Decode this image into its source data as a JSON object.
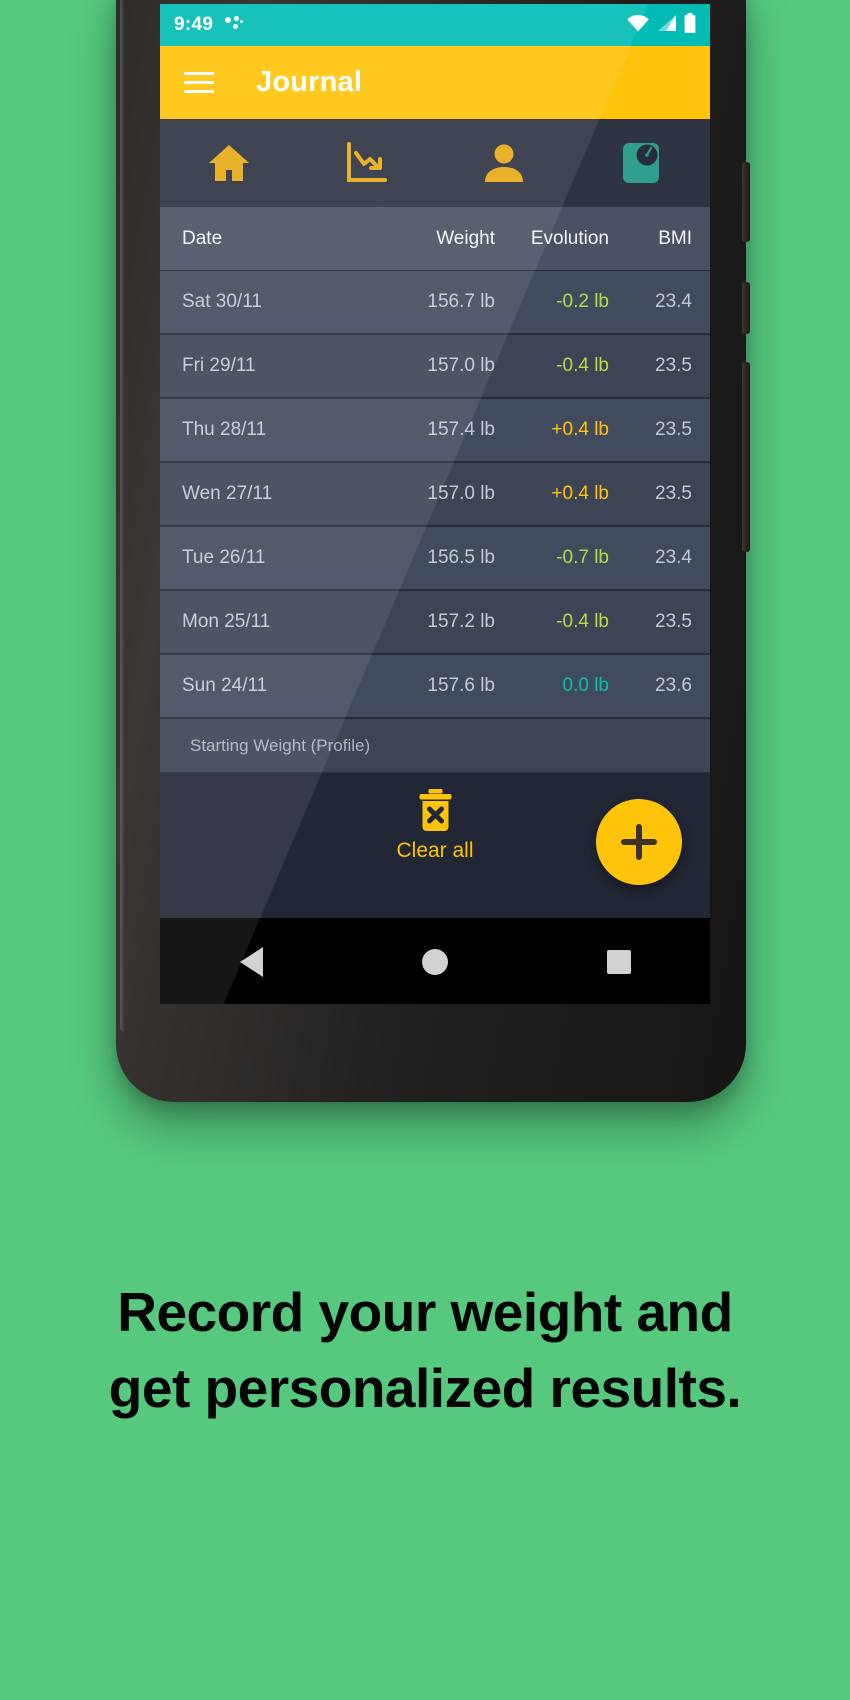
{
  "status_bar": {
    "time": "9:49",
    "icons": [
      "bluetooth-dots-icon",
      "wifi-icon",
      "cellular-signal-icon",
      "battery-icon"
    ],
    "background_color": "#00bcb4"
  },
  "app_bar": {
    "menu_icon": "hamburger-menu-icon",
    "title": "Journal",
    "background_color": "#ffc40a"
  },
  "tabs": [
    {
      "id": "home",
      "icon": "home-icon",
      "active": false
    },
    {
      "id": "trend",
      "icon": "chart-line-down-icon",
      "active": false
    },
    {
      "id": "profile",
      "icon": "person-icon",
      "active": false
    },
    {
      "id": "scale",
      "icon": "weight-scale-icon",
      "active": true
    }
  ],
  "table": {
    "headers": [
      "Date",
      "Weight",
      "Evolution",
      "BMI"
    ],
    "rows": [
      {
        "date": "Sat 30/11",
        "weight": "156.7 lb",
        "evolution": "-0.2 lb",
        "evolution_color": "#b5dd45",
        "bmi": "23.4"
      },
      {
        "date": "Fri 29/11",
        "weight": "157.0 lb",
        "evolution": "-0.4 lb",
        "evolution_color": "#b5dd45",
        "bmi": "23.5"
      },
      {
        "date": "Thu 28/11",
        "weight": "157.4 lb",
        "evolution": "+0.4 lb",
        "evolution_color": "#ffc40a",
        "bmi": "23.5"
      },
      {
        "date": "Wen 27/11",
        "weight": "157.0 lb",
        "evolution": "+0.4 lb",
        "evolution_color": "#ffc40a",
        "bmi": "23.5"
      },
      {
        "date": "Tue 26/11",
        "weight": "156.5 lb",
        "evolution": "-0.7 lb",
        "evolution_color": "#b5dd45",
        "bmi": "23.4"
      },
      {
        "date": "Mon 25/11",
        "weight": "157.2 lb",
        "evolution": "-0.4 lb",
        "evolution_color": "#b5dd45",
        "bmi": "23.5"
      },
      {
        "date": "Sun 24/11",
        "weight": "157.6 lb",
        "evolution": "0.0 lb",
        "evolution_color": "#00c4a7",
        "bmi": "23.6"
      }
    ],
    "footnote": "Starting Weight (Profile)"
  },
  "action_bar": {
    "clear_icon": "trash-x-icon",
    "clear_label": "Clear all",
    "add_icon": "plus-icon",
    "accent_color": "#ffc40a"
  },
  "nav_bar": {
    "back_icon": "triangle-back-icon",
    "home_icon": "circle-home-icon",
    "recents_icon": "square-recents-icon"
  },
  "caption": {
    "line1": "Record your weight and",
    "line2": "get personalized results.",
    "background_color": "#57c97f"
  }
}
